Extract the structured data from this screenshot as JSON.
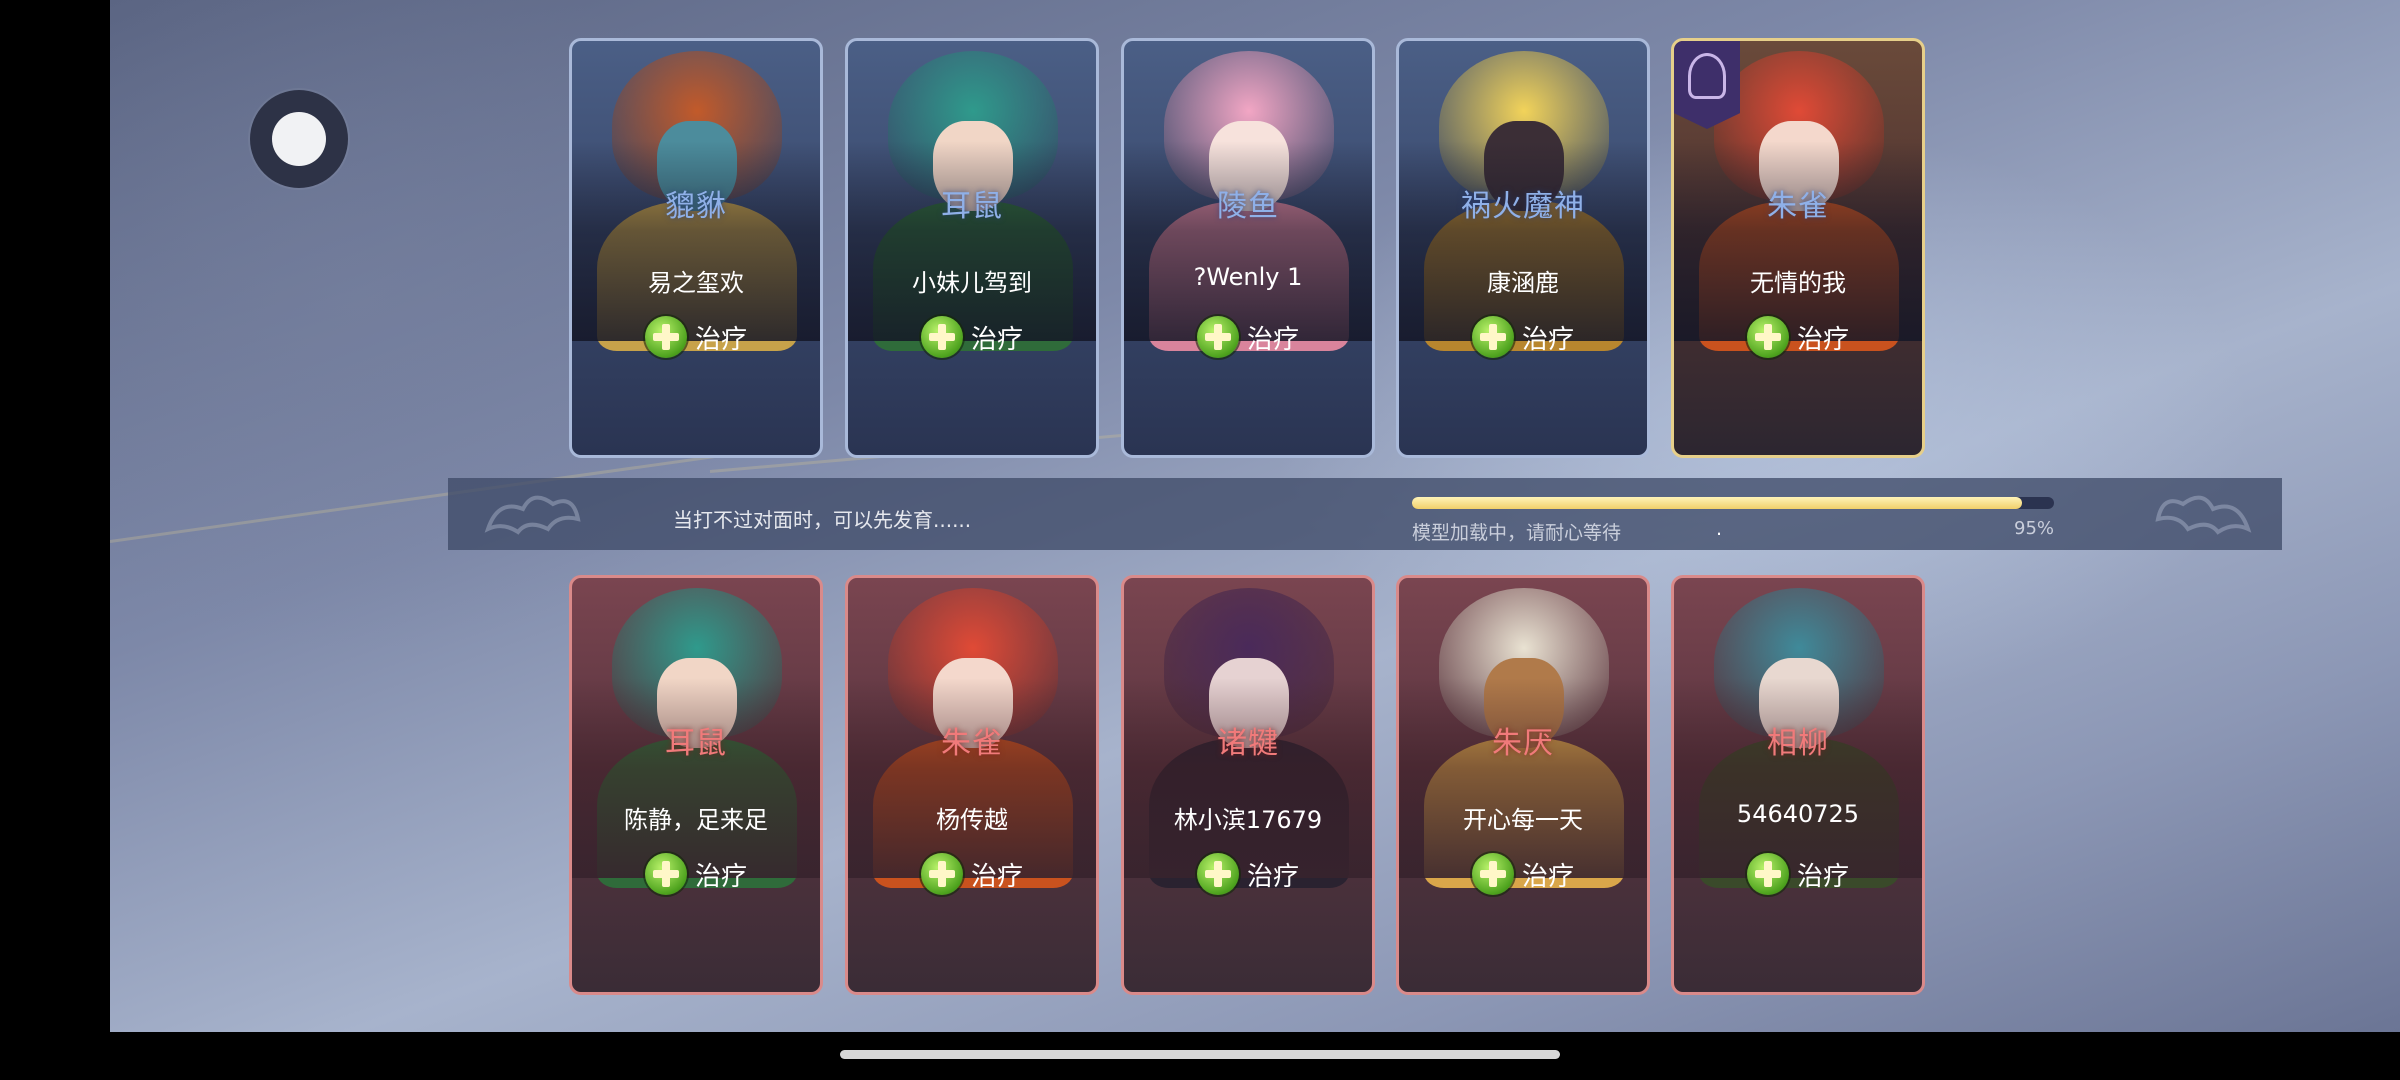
{
  "top_team": [
    {
      "hero": "貔貅",
      "player": "易之玺欢",
      "role": "治疗",
      "frame": "blue",
      "hair": "#c25a2a",
      "skin": "#4c8c9c",
      "cloth": "#c7a24a"
    },
    {
      "hero": "耳鼠",
      "player": "小妹儿驾到",
      "role": "治疗",
      "frame": "blue",
      "hair": "#2f9a8c",
      "skin": "#f1d6c6",
      "cloth": "#2f6b3a"
    },
    {
      "hero": "陵鱼",
      "player": "?Wenly 1",
      "role": "治疗",
      "frame": "blue",
      "hair": "#f2a6c4",
      "skin": "#f7e2dc",
      "cloth": "#d9849c"
    },
    {
      "hero": "祸火魔神",
      "player": "康涵鹿",
      "role": "治疗",
      "frame": "blue",
      "hair": "#f2d35a",
      "skin": "#3b2e36",
      "cloth": "#b8862e"
    },
    {
      "hero": "朱雀",
      "player": "无情的我",
      "role": "治疗",
      "frame": "gold",
      "hair": "#e04a36",
      "skin": "#f4d8cc",
      "cloth": "#c9521e",
      "badge": "rank-badge"
    }
  ],
  "bottom_team": [
    {
      "hero": "耳鼠",
      "player": "陈静，足来足",
      "role": "治疗",
      "frame": "red",
      "hair": "#2f9a8c",
      "skin": "#f1d6c6",
      "cloth": "#2f6b3a"
    },
    {
      "hero": "朱雀",
      "player": "杨传越",
      "role": "治疗",
      "frame": "red",
      "hair": "#e04a36",
      "skin": "#f4d8cc",
      "cloth": "#c9521e"
    },
    {
      "hero": "诸犍",
      "player": "林小滨17679",
      "role": "治疗",
      "frame": "red",
      "hair": "#4a2a5a",
      "skin": "#e6d2d2",
      "cloth": "#2a2230"
    },
    {
      "hero": "朱厌",
      "player": "开心每一天",
      "role": "治疗",
      "frame": "red",
      "hair": "#e9e2d2",
      "skin": "#b07a4a",
      "cloth": "#d9a64a"
    },
    {
      "hero": "相柳",
      "player": "54640725",
      "role": "治疗",
      "frame": "red",
      "hair": "#3f8a9a",
      "skin": "#e8d8d0",
      "cloth": "#3a4a2a"
    }
  ],
  "loading": {
    "tip": "当打不过对面时，可以先发育......",
    "status": "模型加载中，请耐心等待",
    "dot": ".",
    "percent_label": "95%",
    "progress": 0.95
  },
  "colors": {
    "progress": "#f1cf6a",
    "role_icon": "#4ea31e"
  },
  "icons": {
    "role": "plus-heal-icon",
    "float_button": "assistive-touch-icon"
  }
}
